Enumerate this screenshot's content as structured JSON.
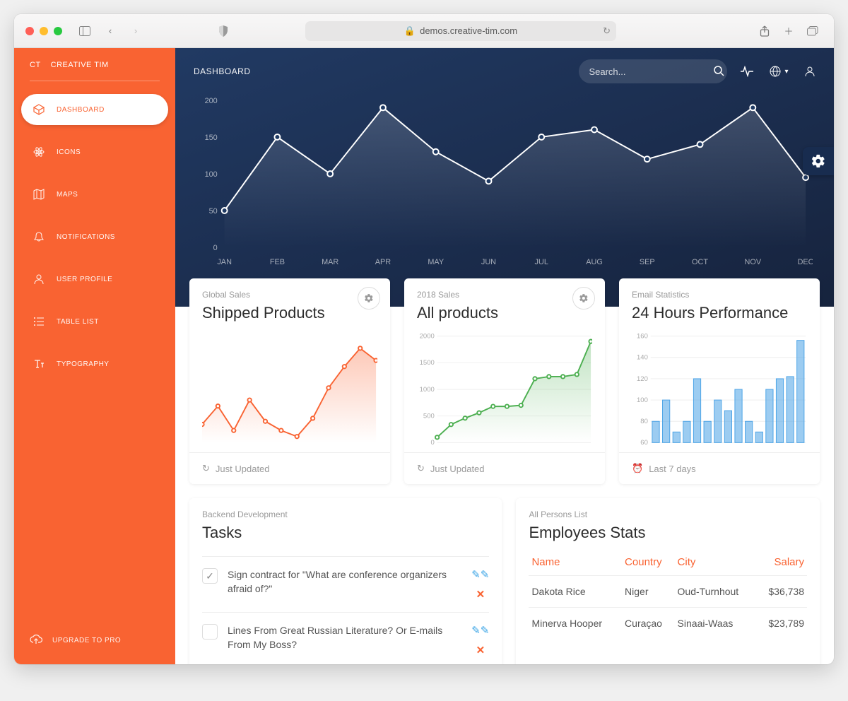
{
  "browser": {
    "url": "demos.creative-tim.com"
  },
  "brand": {
    "logo_text": "CT",
    "name": "CREATIVE TIM"
  },
  "sidebar": {
    "items": [
      {
        "label": "DASHBOARD",
        "icon": "cube",
        "active": true
      },
      {
        "label": "ICONS",
        "icon": "atom"
      },
      {
        "label": "MAPS",
        "icon": "map"
      },
      {
        "label": "NOTIFICATIONS",
        "icon": "bell"
      },
      {
        "label": "USER PROFILE",
        "icon": "user"
      },
      {
        "label": "TABLE LIST",
        "icon": "list"
      },
      {
        "label": "TYPOGRAPHY",
        "icon": "text"
      }
    ],
    "upgrade": "UPGRADE TO PRO"
  },
  "topbar": {
    "title": "DASHBOARD",
    "search_placeholder": "Search..."
  },
  "chart_data": [
    {
      "id": "hero",
      "type": "line",
      "categories": [
        "JAN",
        "FEB",
        "MAR",
        "APR",
        "MAY",
        "JUN",
        "JUL",
        "AUG",
        "SEP",
        "OCT",
        "NOV",
        "DEC"
      ],
      "values": [
        50,
        150,
        100,
        190,
        130,
        90,
        150,
        160,
        120,
        140,
        190,
        95
      ],
      "ylim": [
        0,
        200
      ],
      "yticks": [
        0,
        50,
        100,
        150,
        200
      ]
    },
    {
      "id": "shipped",
      "type": "area-line",
      "title": "Shipped Products",
      "eyebrow": "Global Sales",
      "footer": "Just Updated",
      "x": [
        0,
        1,
        2,
        3,
        4,
        5,
        6,
        7,
        8,
        9,
        10,
        11
      ],
      "values": [
        310,
        370,
        290,
        390,
        320,
        290,
        270,
        330,
        430,
        500,
        560,
        520
      ],
      "ylim": [
        250,
        600
      ],
      "color": "#f96332"
    },
    {
      "id": "allproducts",
      "type": "area-line",
      "title": "All products",
      "eyebrow": "2018 Sales",
      "footer": "Just Updated",
      "x": [
        0,
        1,
        2,
        3,
        4,
        5,
        6,
        7,
        8,
        9,
        10,
        11
      ],
      "yticks": [
        0,
        500,
        1000,
        1500,
        2000
      ],
      "values": [
        100,
        340,
        460,
        560,
        680,
        680,
        700,
        1200,
        1240,
        1240,
        1280,
        1900
      ],
      "ylim": [
        0,
        2000
      ],
      "color": "#4caf50"
    },
    {
      "id": "email",
      "type": "bar",
      "title": "24 Hours Performance",
      "eyebrow": "Email Statistics",
      "footer": "Last 7 days",
      "yticks": [
        60,
        80,
        100,
        120,
        140,
        160
      ],
      "categories": [
        1,
        2,
        3,
        4,
        5,
        6,
        7,
        8,
        9,
        10,
        11,
        12,
        13
      ],
      "values": [
        80,
        100,
        70,
        80,
        120,
        80,
        100,
        90,
        110,
        80,
        70,
        110,
        120,
        122,
        156
      ],
      "ylim": [
        60,
        160
      ],
      "color": "#4aa3e6"
    }
  ],
  "tasks": {
    "eyebrow": "Backend Development",
    "title": "Tasks",
    "items": [
      {
        "text": "Sign contract for \"What are conference organizers afraid of?\"",
        "checked": true
      },
      {
        "text": "Lines From Great Russian Literature? Or E-mails From My Boss?",
        "checked": false
      }
    ]
  },
  "employees": {
    "eyebrow": "All Persons List",
    "title": "Employees Stats",
    "columns": [
      "Name",
      "Country",
      "City",
      "Salary"
    ],
    "rows": [
      {
        "name": "Dakota Rice",
        "country": "Niger",
        "city": "Oud-Turnhout",
        "salary": "$36,738"
      },
      {
        "name": "Minerva Hooper",
        "country": "Curaçao",
        "city": "Sinaai-Waas",
        "salary": "$23,789"
      }
    ]
  }
}
